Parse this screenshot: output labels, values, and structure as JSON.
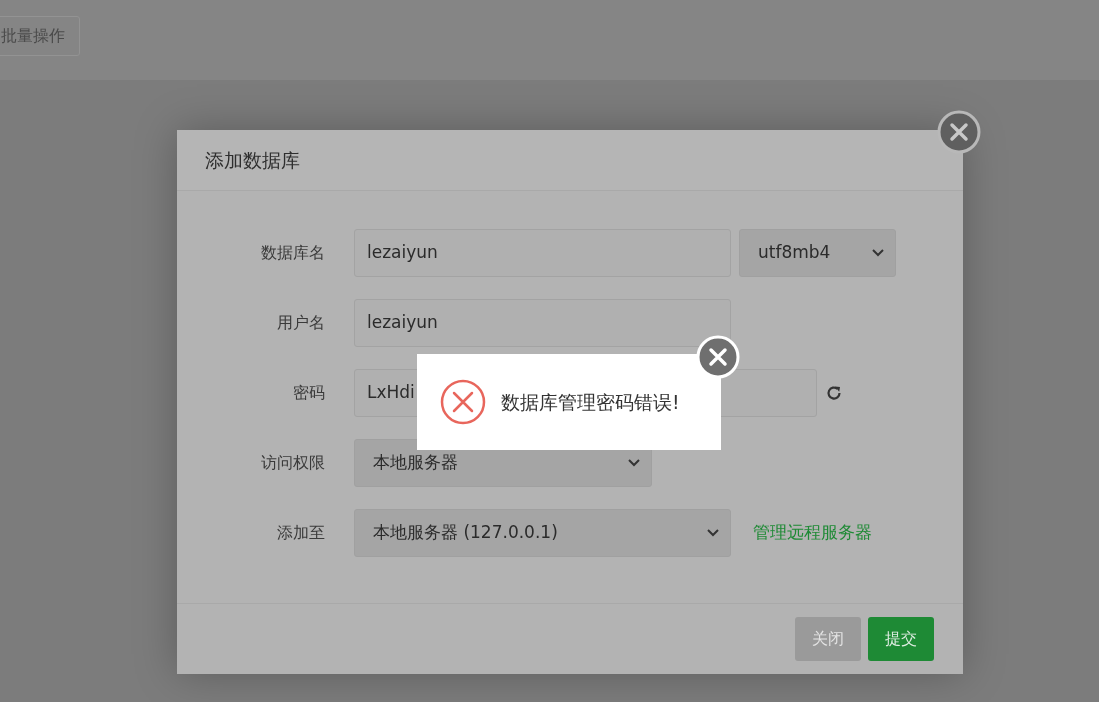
{
  "toolbar": {
    "batch_button": "批量操作"
  },
  "dialog": {
    "title": "添加数据库",
    "fields": [
      {
        "kind": "text-with-select",
        "label": "数据库名",
        "value": "lezaiyun",
        "select": "utf8mb4"
      },
      {
        "kind": "text",
        "label": "用户名",
        "value": "lezaiyun"
      },
      {
        "kind": "password",
        "label": "密码",
        "value": "LxHdi"
      },
      {
        "kind": "select",
        "label": "访问权限",
        "value": "本地服务器"
      },
      {
        "kind": "select-with-link",
        "label": "添加至",
        "value": "本地服务器 (127.0.0.1)",
        "link": "管理远程服务器"
      }
    ],
    "buttons": [
      {
        "label": "关闭",
        "kind": "secondary"
      },
      {
        "label": "提交",
        "kind": "primary"
      }
    ]
  },
  "alert": {
    "message": "数据库管理密码错误!"
  }
}
